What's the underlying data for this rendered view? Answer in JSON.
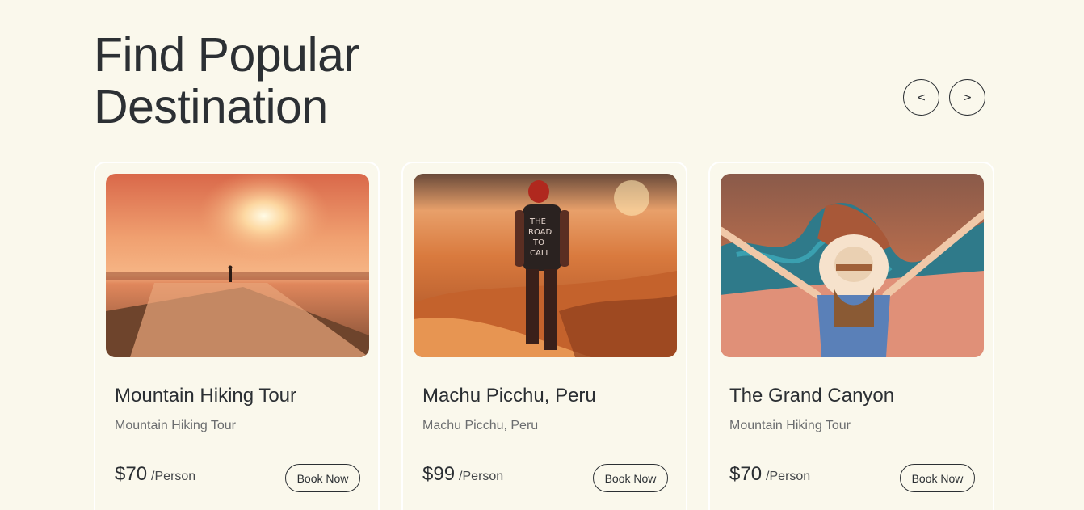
{
  "header": {
    "title_line1": "Find Popular",
    "title_line2": "Destination"
  },
  "nav": {
    "prev_label": "<",
    "next_label": ">"
  },
  "cards": [
    {
      "title": "Mountain Hiking Tour",
      "subtitle": "Mountain Hiking Tour",
      "price": "$70",
      "unit": "/Person",
      "button": "Book Now",
      "image": "sunset-pier-photo"
    },
    {
      "title": "Machu Picchu, Peru",
      "subtitle": "Machu Picchu, Peru",
      "price": "$99",
      "unit": "/Person",
      "button": "Book Now",
      "image": "desert-traveler-photo"
    },
    {
      "title": "The Grand Canyon",
      "subtitle": "Mountain Hiking Tour",
      "price": "$70",
      "unit": "/Person",
      "button": "Book Now",
      "image": "canyon-traveler-photo"
    }
  ],
  "colors": {
    "background": "#faf8ec",
    "text": "#2b2f33",
    "muted": "#6b6d6f",
    "card_border": "#ffffff"
  }
}
